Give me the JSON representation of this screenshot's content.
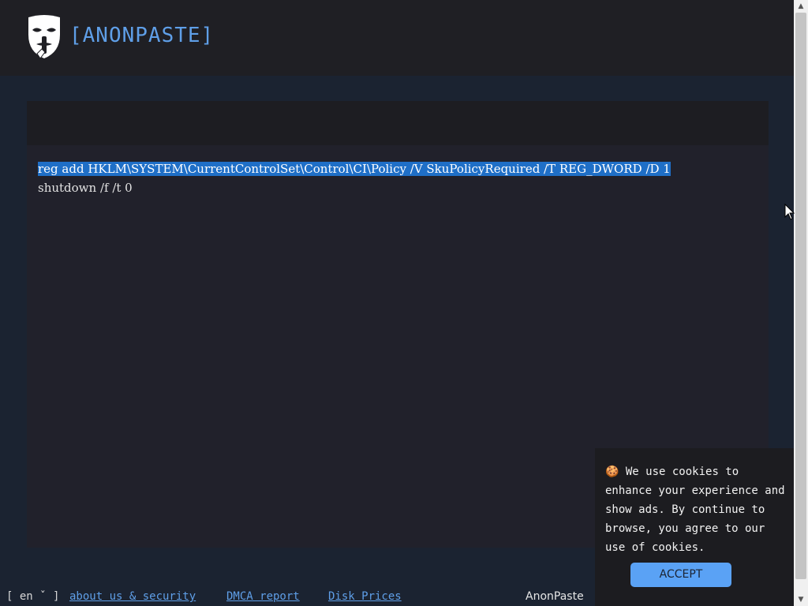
{
  "header": {
    "brand": "[ANONPASTE]",
    "logo_icon": "anonymous-mask-logo"
  },
  "paste": {
    "lines": [
      "reg add HKLM\\SYSTEM\\CurrentControlSet\\Control\\CI\\Policy /V SkuPolicyRequired /T REG_DWORD /D 1",
      "shutdown /f /t 0"
    ],
    "selected_line_index": 0
  },
  "footer": {
    "language": "[ en ˇ ]",
    "links": [
      "about us & security",
      "DMCA report",
      "Disk Prices"
    ],
    "site_name": "AnonPaste"
  },
  "cookie_banner": {
    "text": "We use cookies to enhance your experience and show ads. By continue to browse, you agree to our use of cookies.",
    "accept_label": "ACCEPT",
    "icon": "cookie-icon"
  },
  "colors": {
    "accent": "#5f9fe8",
    "background": "#1b2331",
    "selection": "#1f6fc7",
    "button": "#5aa2f5"
  }
}
